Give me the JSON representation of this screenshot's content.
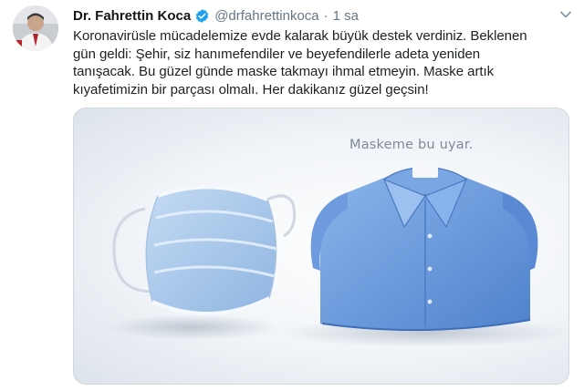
{
  "tweet": {
    "author": {
      "display_name": "Dr. Fahrettin Koca",
      "handle": "@drfahrettinkoca",
      "verified": true,
      "avatar_icon": "profile-photo"
    },
    "separator": "·",
    "timestamp": "1 sa",
    "text": "Koronavirüsle mücadelemize evde kalarak büyük destek verdiniz. Beklenen\ngün geldi: Şehir, siz hanımefendiler ve beyefendilerle adeta yeniden\ntanışacak. Bu güzel günde maske takmayı ihmal etmeyin. Maske artık\nkıyafetimizin bir parçası olmalı. Her dakikanız güzel geçsin!",
    "media": {
      "caption": "Maskeme bu uyar.",
      "depicts": [
        "surgical-mask",
        "folded-blue-shirt"
      ]
    },
    "menu_icon": "chevron-down-icon"
  },
  "colors": {
    "verified_badge": "#1da1f2",
    "secondary_text": "#657786",
    "mask_blue": "#a7c6e8",
    "shirt_blue": "#6f9fde"
  }
}
